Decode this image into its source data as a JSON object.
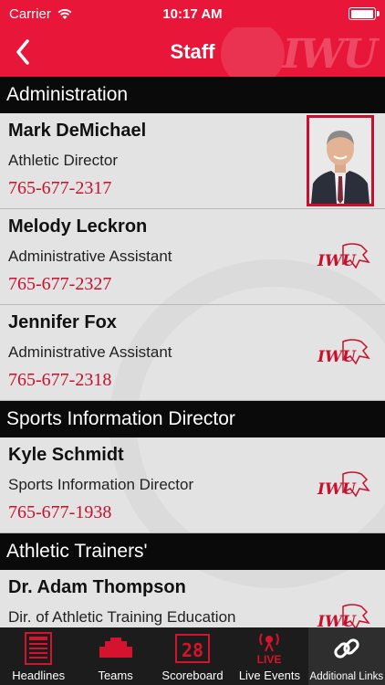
{
  "status_bar": {
    "carrier": "Carrier",
    "time": "10:17 AM"
  },
  "nav": {
    "title": "Staff",
    "watermark": "IWU"
  },
  "sections": [
    {
      "header": "Administration",
      "staff": [
        {
          "name": "Mark DeMichael",
          "title": "Athletic Director",
          "phone": "765-677-2317"
        },
        {
          "name": "Melody Leckron",
          "title": "Administrative Assistant",
          "phone": "765-677-2327"
        },
        {
          "name": "Jennifer Fox",
          "title": "Administrative Assistant",
          "phone": "765-677-2318"
        }
      ]
    },
    {
      "header": "Sports Information Director",
      "staff": [
        {
          "name": "Kyle Schmidt",
          "title": "Sports Information Director",
          "phone": "765-677-1938"
        }
      ]
    },
    {
      "header": "Athletic Trainers'",
      "staff": [
        {
          "name": "Dr. Adam Thompson",
          "title": "Dir. of Athletic Training Education"
        }
      ]
    }
  ],
  "logo_text": "IWU",
  "tabs": [
    {
      "label": "Headlines",
      "icon": "news-icon"
    },
    {
      "label": "Teams",
      "icon": "teams-icon"
    },
    {
      "label": "Scoreboard",
      "icon": "scoreboard-icon",
      "icon_text": "28"
    },
    {
      "label": "Live Events",
      "icon": "live-icon",
      "icon_text": "LIVE"
    },
    {
      "label": "Additional Links",
      "icon": "links-icon"
    }
  ],
  "colors": {
    "brand_red": "#e8173a",
    "phone_red": "#c8102e",
    "header_black": "#0a0a0a",
    "tab_bg": "#1c1c1c"
  }
}
